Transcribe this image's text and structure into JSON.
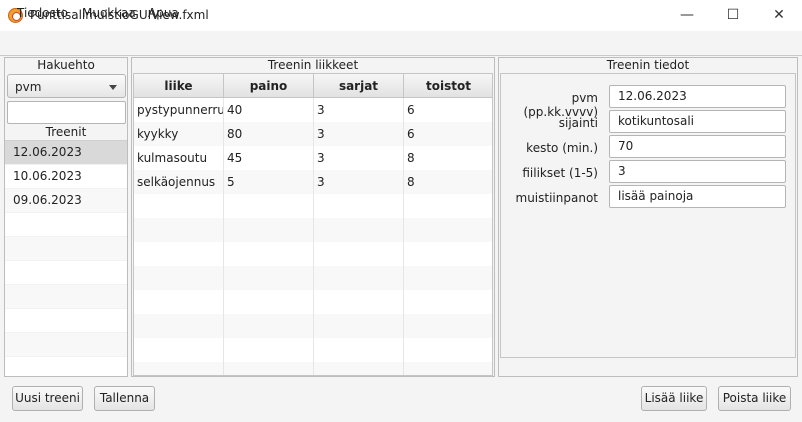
{
  "window": {
    "title": "PunttisalimuistioGUIView.fxml",
    "minimize": "—",
    "maximize": "☐",
    "close": "✕"
  },
  "menu": {
    "items": [
      "Tiedosto",
      "Muokkaa",
      "Apua"
    ]
  },
  "left": {
    "title": "Hakuehto",
    "sort_value": "pvm",
    "search_value": "",
    "list_title": "Treenit",
    "workouts": [
      "12.06.2023",
      "10.06.2023",
      "09.06.2023"
    ]
  },
  "center": {
    "title": "Treenin liikkeet",
    "columns": [
      "liike",
      "paino",
      "sarjat",
      "toistot"
    ],
    "rows": [
      [
        "pystypunnerrus",
        "40",
        "3",
        "6"
      ],
      [
        "kyykky",
        "80",
        "3",
        "6"
      ],
      [
        "kulmasoutu",
        "45",
        "3",
        "8"
      ],
      [
        "selkäojennus",
        "5",
        "3",
        "8"
      ]
    ]
  },
  "right": {
    "title": "Treenin tiedot",
    "fields": [
      {
        "label": "pvm (pp.kk.vvvv)",
        "value": "12.06.2023"
      },
      {
        "label": "sijainti",
        "value": "kotikuntosali"
      },
      {
        "label": "kesto (min.)",
        "value": "70"
      },
      {
        "label": "fiilikset (1-5)",
        "value": "3"
      },
      {
        "label": "muistiinpanot",
        "value": "lisää painoja"
      }
    ]
  },
  "buttons": {
    "new_workout": "Uusi treeni",
    "save": "Tallenna",
    "add_move": "Lisää liike",
    "remove_move": "Poista liike"
  }
}
